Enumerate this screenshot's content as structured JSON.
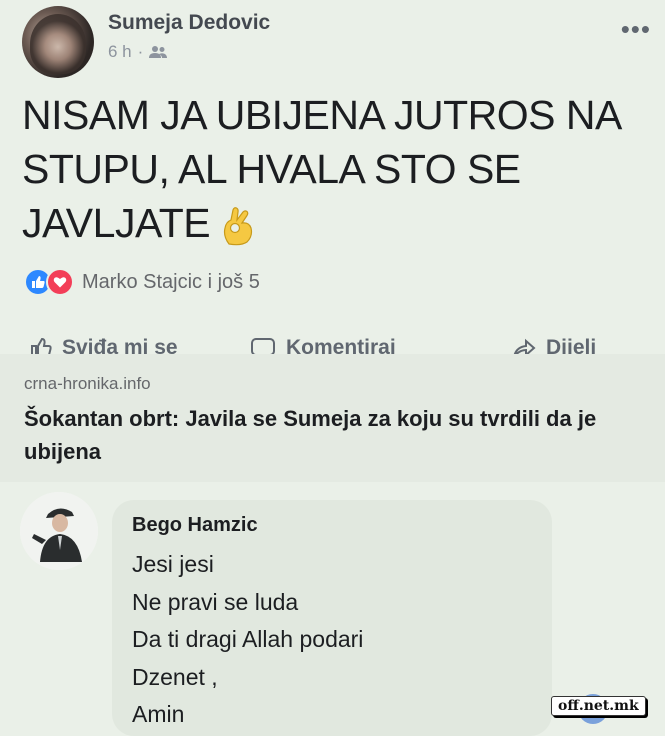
{
  "post": {
    "author": "Sumeja Dedovic",
    "time": "6 h",
    "separator": "·",
    "audience_icon": "friends-icon",
    "more_label": "•••",
    "text_lines": [
      "NISAM JA UBIJENA JUTROS NA",
      "STUPU, AL HVALA STO SE",
      "JAVLJATE"
    ],
    "emoji": "ok-hand-emoji"
  },
  "reactions": {
    "icons": [
      "like-icon",
      "love-icon"
    ],
    "text": "Marko Stajcic i još 5"
  },
  "actions": [
    {
      "label": "Sviđa mi se",
      "icon": "like-icon"
    },
    {
      "label": "Komentiraj",
      "icon": "comment-icon"
    },
    {
      "label": "Dijeli",
      "icon": "share-icon"
    }
  ],
  "link_preview": {
    "domain": "crna-hronika.info",
    "title": "Šokantan obrt: Javila se Sumeja za koju su tvrdili da je ubijena"
  },
  "comment": {
    "author": "Bego Hamzic",
    "lines": [
      "Jesi jesi",
      "Ne pravi se luda",
      "Da ti dragi Allah podari",
      "Dzenet ,",
      "Amin"
    ]
  },
  "watermark": "off.net.mk",
  "colors": {
    "background": "#eaf0e8",
    "like_blue": "#2d88ff",
    "love_red": "#f33e58",
    "secondary_text": "#65676b"
  }
}
